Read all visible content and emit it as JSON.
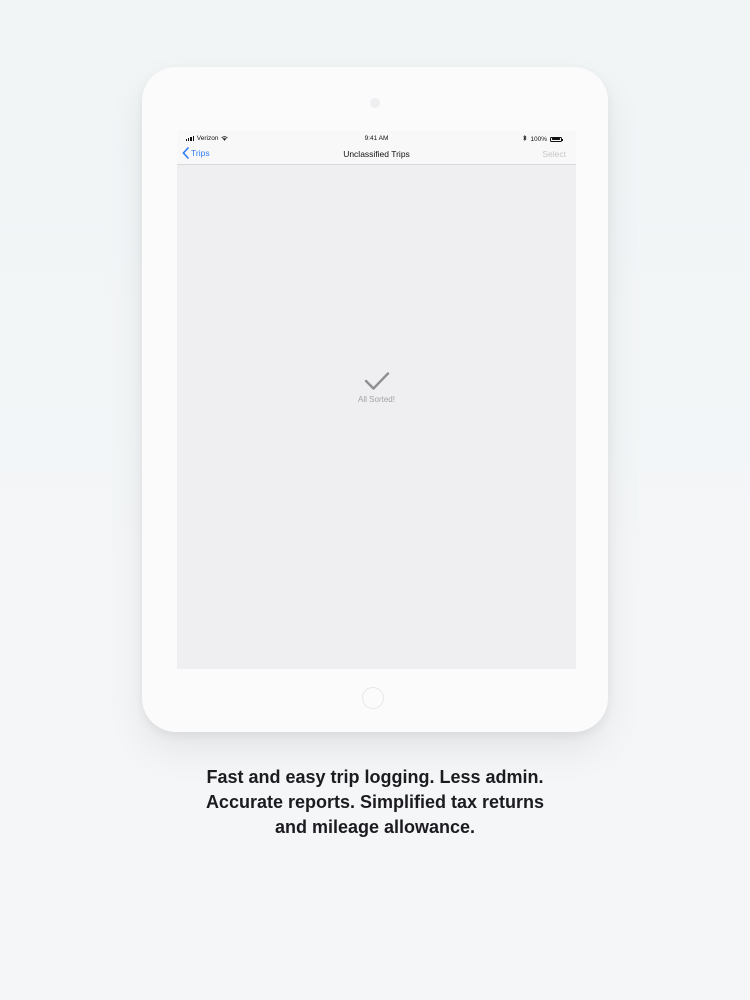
{
  "status_bar": {
    "carrier": "Verizon",
    "time": "9:41 AM",
    "battery_percent": "100%",
    "icons": [
      "signal-icon",
      "wifi-icon",
      "bluetooth-icon",
      "battery-icon"
    ]
  },
  "nav_bar": {
    "back_label": "Trips",
    "title": "Unclassified Trips",
    "select_label": "Select"
  },
  "empty_state": {
    "icon": "checkmark-icon",
    "message": "All Sorted!"
  },
  "caption": {
    "line1": "Fast and easy trip logging. Less admin.",
    "line2": "Accurate reports. Simplified tax returns",
    "line3": "and mileage allowance."
  },
  "colors": {
    "accent": "#2f7cf6",
    "disabled": "#c7c7cc",
    "screen_bg": "#efeff1",
    "caption_text": "#1c1c20"
  }
}
